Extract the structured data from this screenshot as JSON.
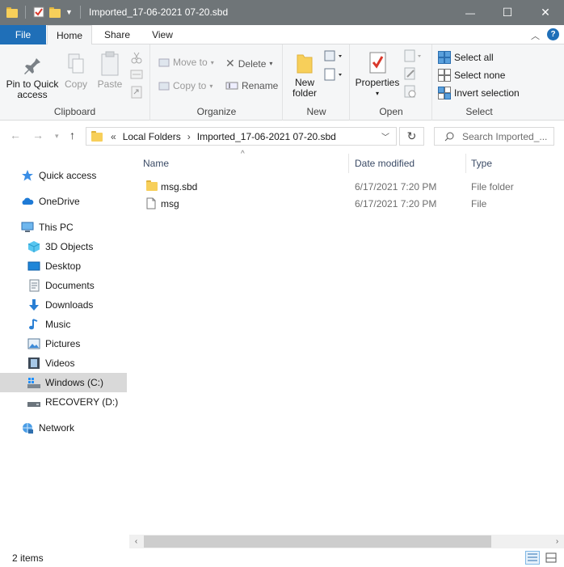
{
  "window": {
    "title": "Imported_17-06-2021 07-20.sbd",
    "controls": {
      "minimize": "—",
      "maximize": "☐",
      "close": "✕"
    }
  },
  "ribbon_tabs": [
    {
      "label": "File"
    },
    {
      "label": "Home"
    },
    {
      "label": "Share"
    },
    {
      "label": "View"
    }
  ],
  "ribbon": {
    "clipboard": {
      "group_label": "Clipboard",
      "pin_line1": "Pin to Quick",
      "pin_line2": "access",
      "copy": "Copy",
      "paste": "Paste"
    },
    "organize": {
      "group_label": "Organize",
      "move_to": "Move to",
      "copy_to": "Copy to",
      "delete": "Delete",
      "rename": "Rename"
    },
    "new": {
      "group_label": "New",
      "new_folder_line1": "New",
      "new_folder_line2": "folder"
    },
    "open": {
      "group_label": "Open",
      "properties": "Properties"
    },
    "select": {
      "group_label": "Select",
      "select_all": "Select all",
      "select_none": "Select none",
      "invert": "Invert selection"
    }
  },
  "address": {
    "overflow": "«",
    "crumbs": [
      "Local Folders",
      "Imported_17-06-2021 07-20.sbd"
    ],
    "separator": "›",
    "search_placeholder": "Search Imported_..."
  },
  "sidebar": {
    "items": [
      {
        "label": "Quick access",
        "icon": "star-icon"
      },
      {
        "label": "OneDrive",
        "icon": "cloud-icon"
      },
      {
        "label": "This PC",
        "icon": "computer-icon"
      },
      {
        "label": "3D Objects",
        "icon": "cube-icon"
      },
      {
        "label": "Desktop",
        "icon": "desktop-icon"
      },
      {
        "label": "Documents",
        "icon": "document-icon"
      },
      {
        "label": "Downloads",
        "icon": "download-arrow-icon"
      },
      {
        "label": "Music",
        "icon": "music-note-icon"
      },
      {
        "label": "Pictures",
        "icon": "picture-icon"
      },
      {
        "label": "Videos",
        "icon": "film-icon"
      },
      {
        "label": "Windows (C:)",
        "icon": "drive-icon",
        "selected": true
      },
      {
        "label": "RECOVERY (D:)",
        "icon": "drive-icon"
      },
      {
        "label": "Network",
        "icon": "network-icon"
      }
    ]
  },
  "file_list": {
    "columns": [
      "Name",
      "Date modified",
      "Type"
    ],
    "sort_indicator": "^",
    "rows": [
      {
        "name": "msg.sbd",
        "date": "6/17/2021 7:20 PM",
        "type": "File folder",
        "icon": "folder-icon"
      },
      {
        "name": "msg",
        "date": "6/17/2021 7:20 PM",
        "type": "File",
        "icon": "file-icon"
      }
    ]
  },
  "status": {
    "item_count": "2 items"
  },
  "colors": {
    "titlebar": "#6f7578",
    "file_tab": "#1f6fb8",
    "folder": "#f7cf5a",
    "selected_nav": "#d9d9d9"
  }
}
